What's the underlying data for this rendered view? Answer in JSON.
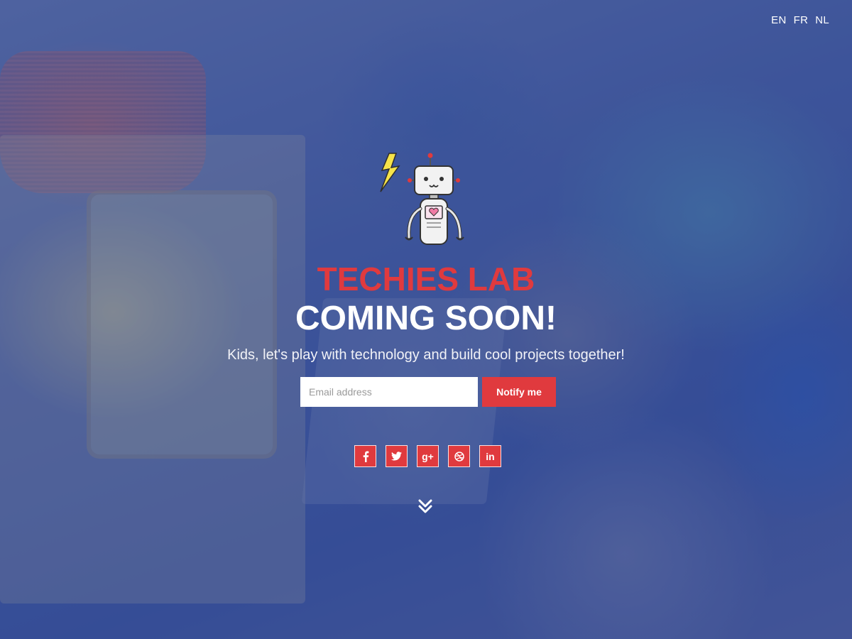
{
  "language_nav": {
    "items": [
      {
        "label": "EN"
      },
      {
        "label": "FR"
      },
      {
        "label": "NL"
      }
    ]
  },
  "hero": {
    "brand": "TECHIES LAB",
    "headline": "COMING SOON!",
    "tagline": "Kids, let's play with technology and build cool projects together!"
  },
  "signup": {
    "email_placeholder": "Email address",
    "button_label": "Notify me"
  },
  "social": {
    "icons": [
      "facebook-icon",
      "twitter-icon",
      "google-plus-icon",
      "dribbble-icon",
      "linkedin-icon"
    ],
    "google_plus_label": "g+",
    "linkedin_label": "in"
  },
  "colors": {
    "accent": "#e03a3e",
    "overlay": "#2846a0",
    "text": "#ffffff"
  }
}
